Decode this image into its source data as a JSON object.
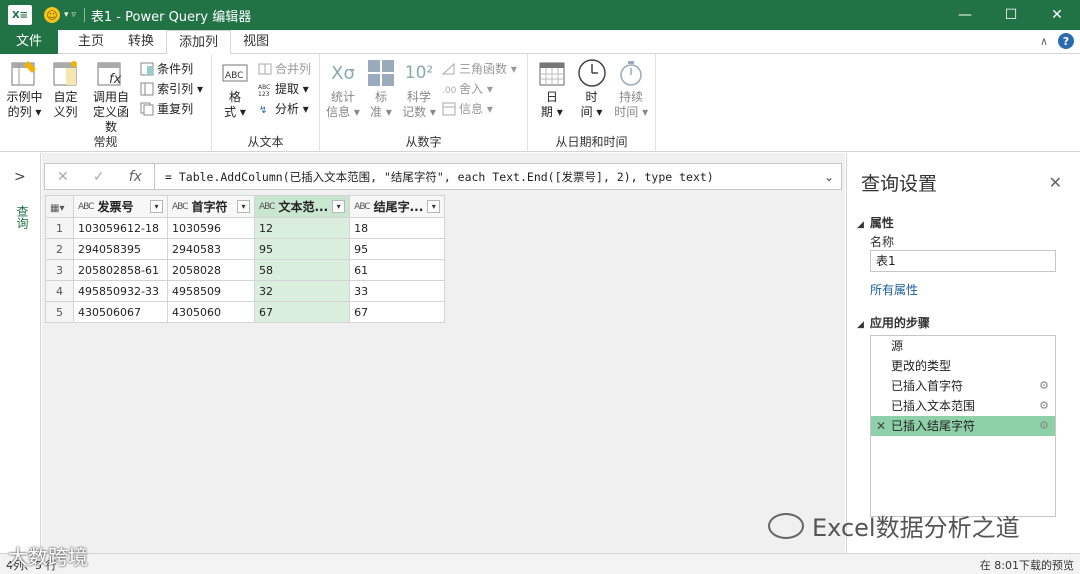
{
  "window": {
    "title": "表1 - Power Query 编辑器",
    "app_badge": "X≡",
    "buttons": [
      "—",
      "☐",
      "✕"
    ]
  },
  "tabs": [
    {
      "label": "文件"
    },
    {
      "label": "主页"
    },
    {
      "label": "转换"
    },
    {
      "label": "添加列"
    },
    {
      "label": "视图"
    }
  ],
  "active_tab": "添加列",
  "ribbon": {
    "groups": [
      {
        "label": "常规",
        "big": [
          {
            "line1": "示例中",
            "line2": "的列 ▾"
          },
          {
            "line1": "自定",
            "line2": "义列"
          },
          {
            "line1": "调用自",
            "line2": "定义函数"
          }
        ],
        "small": [
          {
            "label": "条件列"
          },
          {
            "label": "索引列 ▾"
          },
          {
            "label": "重复列"
          }
        ]
      },
      {
        "label": "从文本",
        "big": [
          {
            "line1": "格",
            "line2": "式 ▾"
          }
        ],
        "small": [
          {
            "label": "合并列"
          },
          {
            "label": "提取 ▾"
          },
          {
            "label": "分析 ▾"
          }
        ]
      },
      {
        "label": "从数字",
        "big": [
          {
            "line1": "统计",
            "line2": "信息 ▾"
          },
          {
            "line1": "标",
            "line2": "准 ▾"
          },
          {
            "line1": "科学",
            "line2": "记数 ▾"
          }
        ],
        "small": [
          {
            "label": "三角函数 ▾"
          },
          {
            "label": "舍入 ▾"
          },
          {
            "label": "信息 ▾"
          }
        ]
      },
      {
        "label": "从日期和时间",
        "big": [
          {
            "line1": "日",
            "line2": "期 ▾"
          },
          {
            "line1": "时",
            "line2": "间 ▾"
          },
          {
            "line1": "持续",
            "line2": "时间 ▾"
          }
        ]
      }
    ]
  },
  "left_pane": {
    "label": "查询"
  },
  "formula_bar": {
    "text": "= Table.AddColumn(已插入文本范围, \"结尾字符\", each Text.End([发票号], 2), type text)"
  },
  "table": {
    "columns": [
      {
        "type": "ABC",
        "name": "发票号"
      },
      {
        "type": "ABC",
        "name": "首字符"
      },
      {
        "type": "ABC",
        "name": "文本范..."
      },
      {
        "type": "ABC",
        "name": "结尾字..."
      }
    ],
    "rows": [
      {
        "n": "1",
        "c": [
          "103059612-18",
          "1030596",
          "12",
          "18"
        ]
      },
      {
        "n": "2",
        "c": [
          "294058395",
          "2940583",
          "95",
          "95"
        ]
      },
      {
        "n": "3",
        "c": [
          "205802858-61",
          "2058028",
          "58",
          "61"
        ]
      },
      {
        "n": "4",
        "c": [
          "495850932-33",
          "4958509",
          "32",
          "33"
        ]
      },
      {
        "n": "5",
        "c": [
          "430506067",
          "4305060",
          "67",
          "67"
        ]
      }
    ]
  },
  "query_settings": {
    "title": "查询设置",
    "properties_header": "属性",
    "name_label": "名称",
    "name_value": "表1",
    "all_properties_link": "所有属性",
    "steps_header": "应用的步骤",
    "steps": [
      {
        "label": "源",
        "gear": false
      },
      {
        "label": "更改的类型",
        "gear": false
      },
      {
        "label": "已插入首字符",
        "gear": true
      },
      {
        "label": "已插入文本范围",
        "gear": true
      },
      {
        "label": "已插入结尾字符",
        "gear": true,
        "active": true
      }
    ]
  },
  "status": {
    "left": "4列、5 行",
    "right": "在 8:01下载的预览"
  },
  "watermarks": {
    "left": "大数跨境",
    "right": "Excel数据分析之道"
  },
  "colors": {
    "brand": "#217346",
    "selected_column": "#d9eedd",
    "active_step": "#8ed0a8"
  }
}
